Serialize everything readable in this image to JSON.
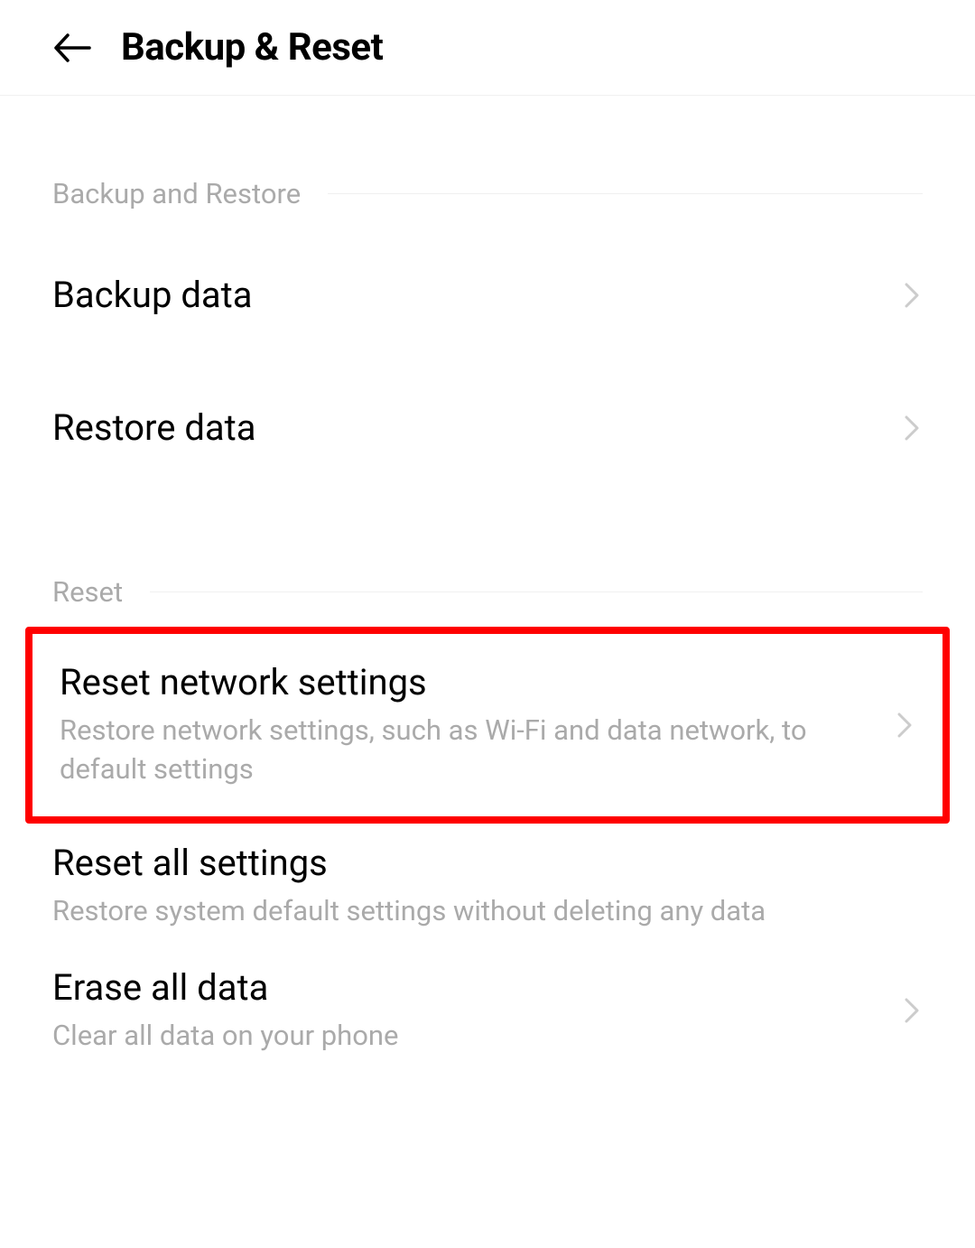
{
  "header": {
    "title": "Backup & Reset"
  },
  "sections": {
    "backup_restore": {
      "label": "Backup and Restore",
      "items": {
        "backup_data": {
          "title": "Backup data"
        },
        "restore_data": {
          "title": "Restore data"
        }
      }
    },
    "reset": {
      "label": "Reset",
      "items": {
        "reset_network": {
          "title": "Reset network settings",
          "subtitle": "Restore network settings, such as Wi-Fi and data network, to default settings"
        },
        "reset_all": {
          "title": "Reset all settings",
          "subtitle": "Restore system default settings without deleting any data"
        },
        "erase_all": {
          "title": "Erase all data",
          "subtitle": "Clear all data on your phone"
        }
      }
    }
  }
}
